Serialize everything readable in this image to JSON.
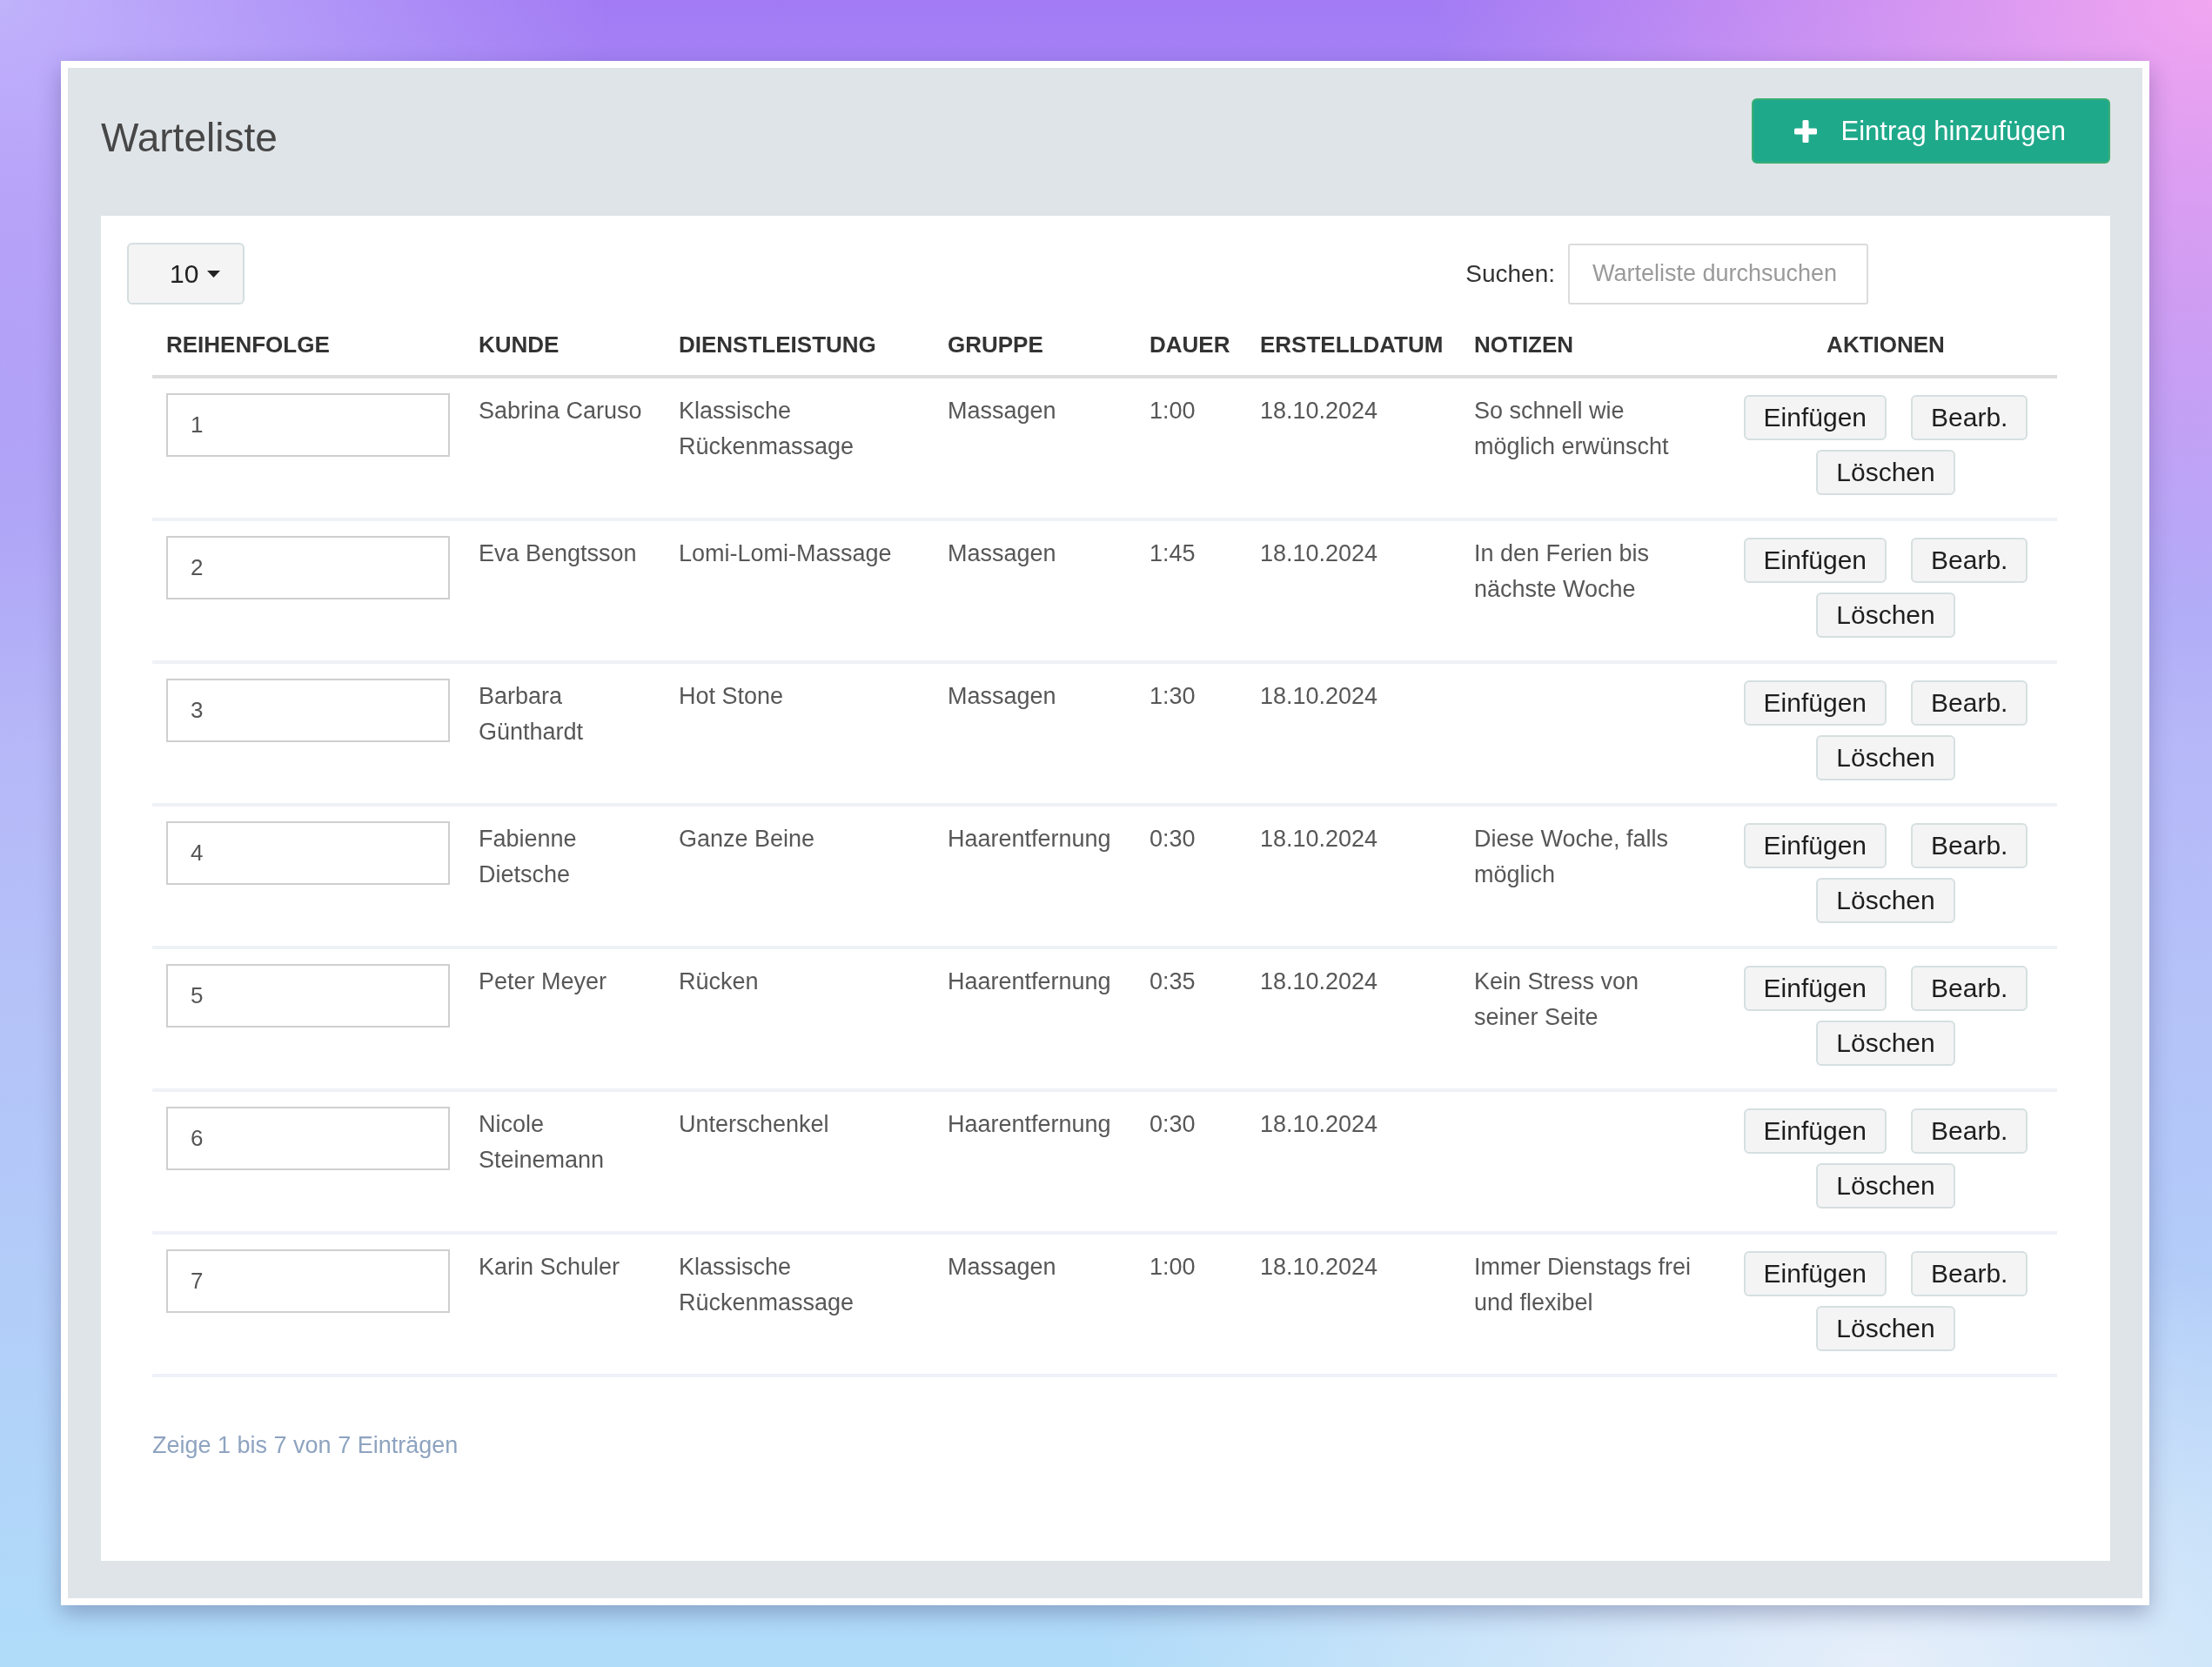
{
  "page": {
    "title": "Warteliste",
    "add_button": {
      "label": "Eintrag hinzufügen"
    }
  },
  "table_controls": {
    "page_size": "10",
    "search": {
      "label": "Suchen:",
      "placeholder": "Warteliste durchsuchen"
    }
  },
  "table": {
    "columns": [
      "REIHENFOLGE",
      "KUNDE",
      "DIENSTLEISTUNG",
      "GRUPPE",
      "DAUER",
      "ERSTELLDATUM",
      "NOTIZEN",
      "AKTIONEN"
    ],
    "rows": [
      {
        "order": "1",
        "customer": "Sabrina Caruso",
        "service": "Klassische Rückenmassage",
        "group": "Massagen",
        "duration": "1:00",
        "created": "18.10.2024",
        "notes": "So schnell wie möglich erwünscht",
        "actions": [
          "Einfügen",
          "Bearb.",
          "Löschen"
        ]
      },
      {
        "order": "2",
        "customer": "Eva Bengtsson",
        "service": "Lomi-Lomi-Massage",
        "group": "Massagen",
        "duration": "1:45",
        "created": "18.10.2024",
        "notes": "In den Ferien bis nächste Woche",
        "actions": [
          "Einfügen",
          "Bearb.",
          "Löschen"
        ]
      },
      {
        "order": "3",
        "customer": "Barbara Günthardt",
        "service": "Hot Stone",
        "group": "Massagen",
        "duration": "1:30",
        "created": "18.10.2024",
        "actions": [
          "Einfügen",
          "Bearb.",
          "Löschen"
        ]
      },
      {
        "order": "4",
        "customer": "Fabienne Dietsche",
        "service": "Ganze Beine",
        "group": "Haarentfernung",
        "duration": "0:30",
        "created": "18.10.2024",
        "notes": "Diese Woche, falls möglich",
        "actions": [
          "Einfügen",
          "Bearb.",
          "Löschen"
        ]
      },
      {
        "order": "5",
        "customer": "Peter Meyer",
        "service": "Rücken",
        "group": "Haarentfernung",
        "duration": "0:35",
        "created": "18.10.2024",
        "notes": "Kein Stress von seiner Seite",
        "actions": [
          "Einfügen",
          "Bearb.",
          "Löschen"
        ]
      },
      {
        "order": "6",
        "customer": "Nicole Steinemann",
        "service": "Unterschenkel",
        "group": "Haarentfernung",
        "duration": "0:30",
        "created": "18.10.2024",
        "actions": [
          "Einfügen",
          "Bearb.",
          "Löschen"
        ]
      },
      {
        "order": "7",
        "customer": "Karin Schuler",
        "service": "Klassische Rückenmassage",
        "group": "Massagen",
        "duration": "1:00",
        "created": "18.10.2024",
        "notes": "Immer Dienstags frei und flexibel",
        "actions": [
          "Einfügen",
          "Bearb.",
          "Löschen"
        ]
      }
    ]
  },
  "footer": {
    "info": "Zeige 1 bis 7 von 7 Einträgen"
  }
}
